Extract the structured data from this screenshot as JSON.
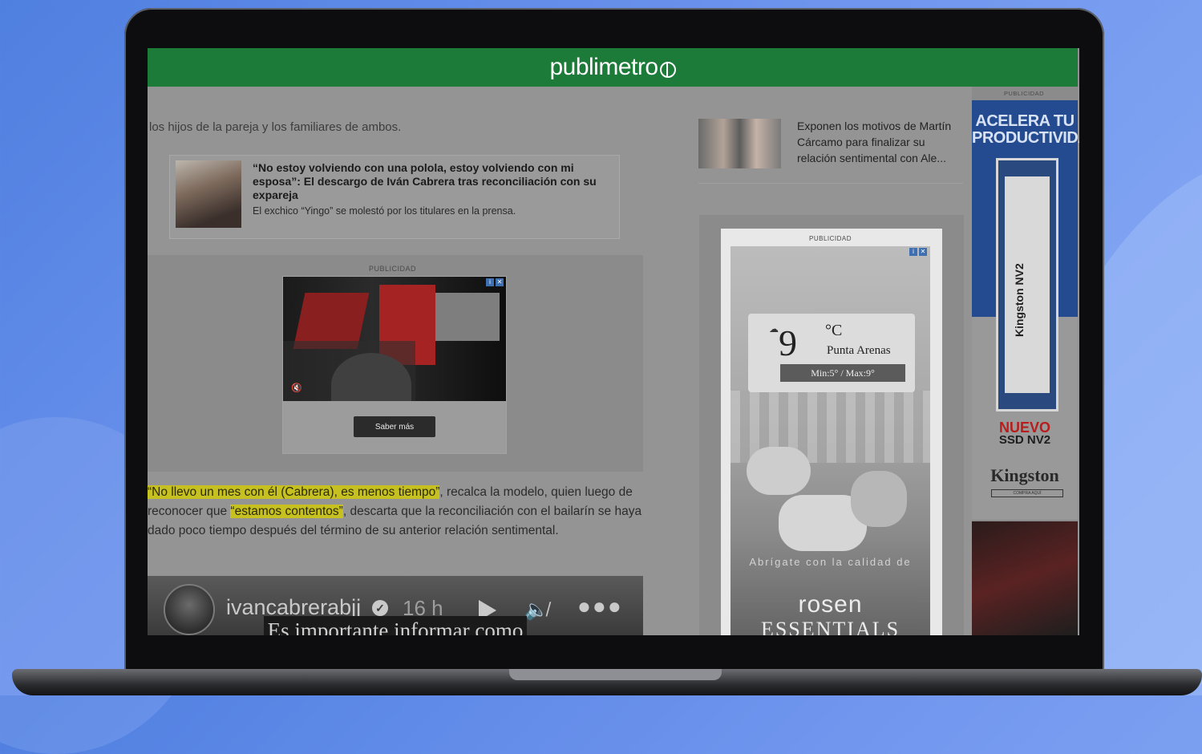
{
  "site": {
    "logo": "publimetro"
  },
  "article": {
    "cut_line": "los hijos de la pareja y los familiares de ambos.",
    "paragraph_parts": [
      "“No llevo un mes con él (Cabrera), es menos tiempo”",
      ", recalca la modelo, quien luego de reconocer que ",
      "“estamos contentos”",
      ", descarta que la reconciliación con el bailarín se haya dado poco tiempo después del término de su anterior relación sentimental."
    ]
  },
  "related_card": {
    "title": "“No estoy volviendo con una polola, estoy volviendo con mi esposa”: El descargo de Iván Cabrera tras reconciliación con su expareja",
    "subtitle": "El exchico “Yingo” se molestó por los titulares en la prensa."
  },
  "ad_video": {
    "label": "PUBLICIDAD",
    "cta": "Saber más"
  },
  "instagram_story": {
    "username": "ivancabrerabjj",
    "time": "16 h",
    "caption": "Es importante informar como corresponde, no es"
  },
  "sidebar_related": {
    "text": "Exponen los motivos de Martín Cárcamo para finalizar su relación sentimental con Ale..."
  },
  "ad_weather": {
    "label": "PUBLICIDAD",
    "temperature": "9",
    "unit": "°C",
    "city": "Punta Arenas",
    "minmax": "Min:5° / Max:9°",
    "tagline": "Abrígate con la calidad de",
    "brand_line1": "rosen",
    "brand_line2": "ESSENTIALS"
  },
  "ad_kingston": {
    "label": "PUBLICIDAD",
    "headline": "ACELERA TU PRODUCTIVIDAD",
    "product": "Kingston NV2",
    "nuevo": "NUEVO",
    "ssd": "SSD NV2",
    "brand": "Kingston",
    "brand_bar": "COMPRA AQUÍ"
  }
}
